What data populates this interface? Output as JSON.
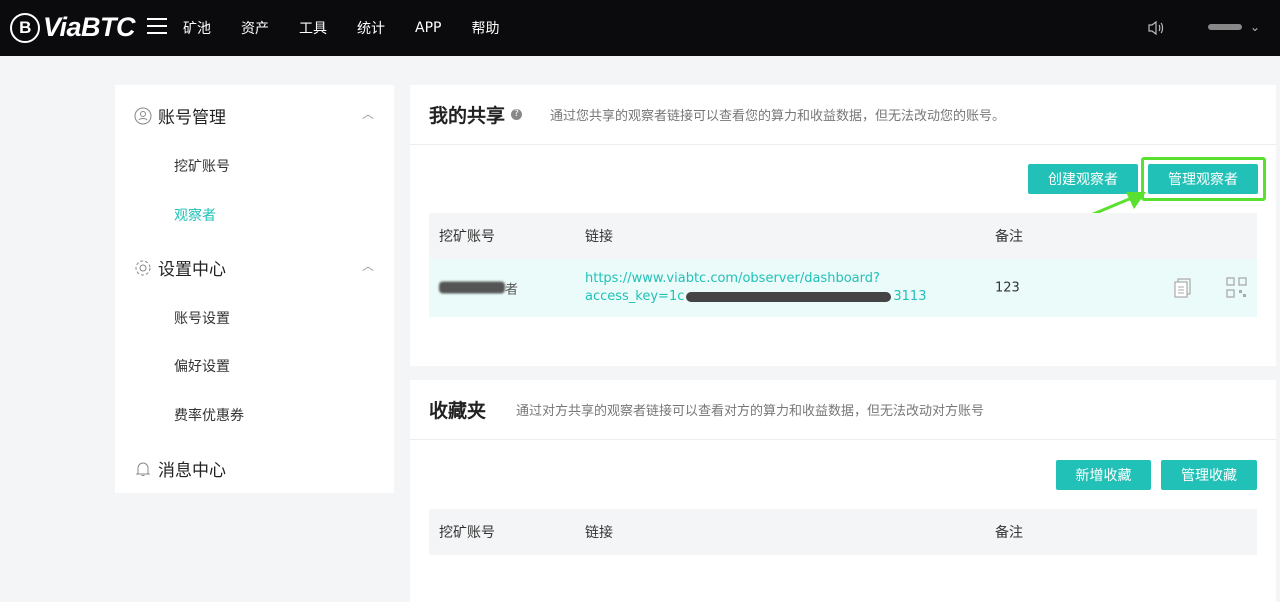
{
  "topbar": {
    "logo_mark": "B",
    "logo_text": "ViaBTC",
    "nav": [
      "矿池",
      "资产",
      "工具",
      "统计",
      "APP",
      "帮助"
    ],
    "user_caret": "⌄"
  },
  "sidebar": {
    "account_title": "账号管理",
    "account_items": [
      "挖矿账号",
      "观察者"
    ],
    "settings_title": "设置中心",
    "settings_items": [
      "账号设置",
      "偏好设置",
      "费率优惠券"
    ],
    "message_title": "消息中心",
    "chevron": "︿"
  },
  "share": {
    "title": "我的共享",
    "help": "?",
    "desc": "通过您共享的观察者链接可以查看您的算力和收益数据，但无法改动您的账号。",
    "create_btn": "创建观察者",
    "manage_btn": "管理观察者",
    "columns": [
      "挖矿账号",
      "链接",
      "备注"
    ],
    "rows": [
      {
        "account_suffix": "者",
        "link_line1": "https://www.viabtc.com/observer/dashboard?",
        "link_prefix": "access_key=1c",
        "link_suffix": "3113",
        "note": "123"
      }
    ]
  },
  "favorites": {
    "title": "收藏夹",
    "desc": "通过对方共享的观察者链接可以查看对方的算力和收益数据，但无法改动对方账号",
    "add_btn": "新增收藏",
    "manage_btn": "管理收藏",
    "columns": [
      "挖矿账号",
      "链接",
      "备注"
    ]
  },
  "colors": {
    "accent": "#21c1b7",
    "highlight": "#5ae02e",
    "topbar": "#0b0b0d"
  }
}
